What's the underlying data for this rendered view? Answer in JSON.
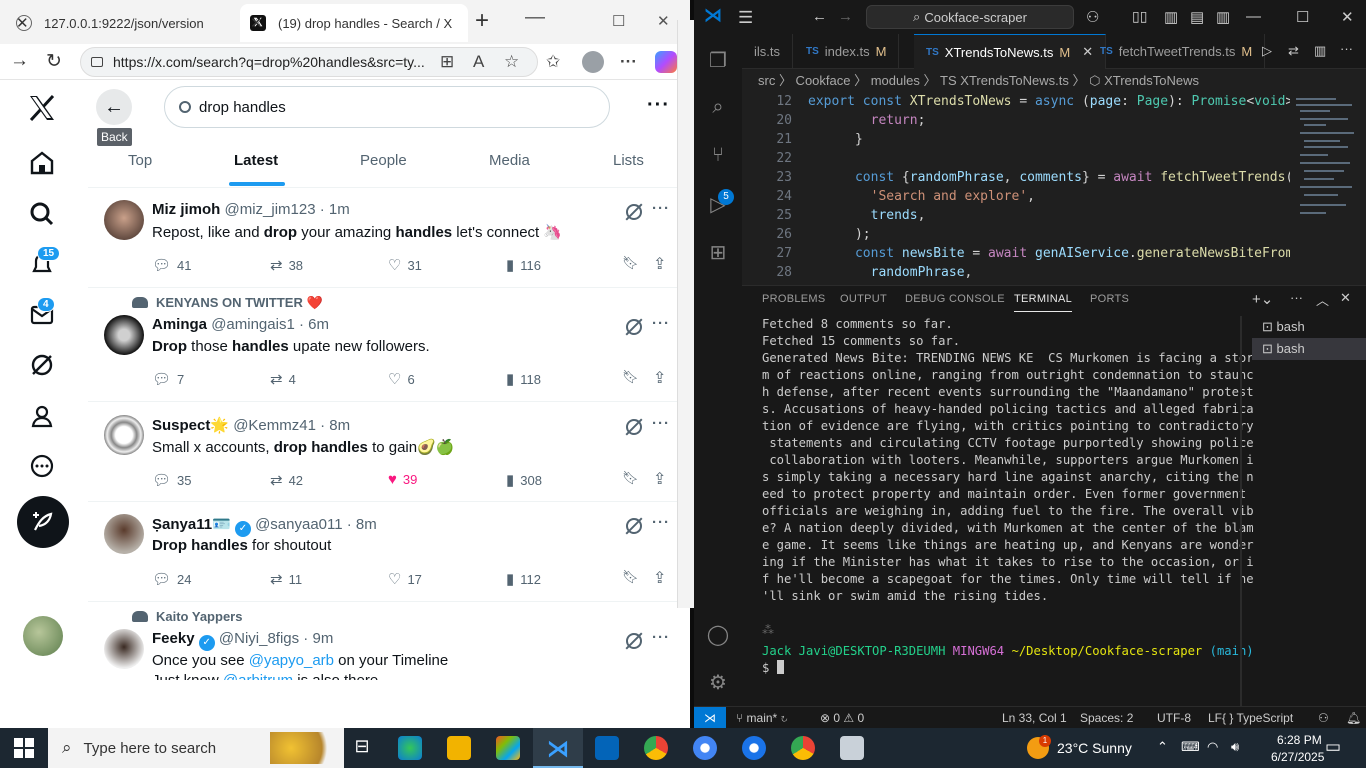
{
  "browser": {
    "tabs": [
      {
        "title": "127.0.0.1:9222/json/version"
      },
      {
        "title": "(19) drop handles - Search / X"
      }
    ],
    "address": "https://x.com/search?q=drop%20handles&src=ty..."
  },
  "x": {
    "back_tooltip": "Back",
    "search_value": "drop handles",
    "badges": {
      "notifications": "15",
      "messages": "4"
    },
    "tabs": [
      "Top",
      "Latest",
      "People",
      "Media",
      "Lists"
    ],
    "tweets": [
      {
        "name": "Miz jimoh",
        "handle": "@miz_jim123 · 1m",
        "context": "",
        "text_pre": "Repost, like and ",
        "b1": "drop",
        "text_mid": " your amazing ",
        "b2": "handles",
        "text_post": " let's connect 🦄",
        "replies": "41",
        "reposts": "38",
        "likes": "31",
        "views": "116"
      },
      {
        "name": "Aminga",
        "handle": "@amingais1 · 6m",
        "context": "KENYANS ON TWITTER ❤️",
        "text_pre": "",
        "b1": "Drop",
        "text_mid": " those ",
        "b2": "handles",
        "text_post": " upate new followers.",
        "replies": "7",
        "reposts": "4",
        "likes": "6",
        "views": "118"
      },
      {
        "name": "Suspect🌟",
        "handle": "@Kemmz41 · 8m",
        "context": "",
        "text_pre": "Small x accounts, ",
        "b1": "drop handles",
        "text_mid": "",
        "b2": "",
        "text_post": " to gain🥑🍏",
        "replies": "35",
        "reposts": "42",
        "likes": "39",
        "views": "308"
      },
      {
        "name": "Ṣanya11🪪",
        "handle": "@sanyaa011 · 8m",
        "context": "",
        "text_pre": "",
        "b1": "Drop handles",
        "text_mid": "",
        "b2": "",
        "text_post": " for shoutout",
        "replies": "24",
        "reposts": "11",
        "likes": "17",
        "views": "112"
      },
      {
        "name": "Feeky",
        "handle": "@Niyi_8figs · 9m",
        "context": "Kaito Yappers",
        "text_pre": "Once you see ",
        "link1": "@yapyo_arb",
        "text_post": " on your Timeline",
        "line2_pre": "Just know ",
        "link2": "@arbitrum",
        "line2_post": " is also there"
      }
    ]
  },
  "vscode": {
    "command_center": "Cookface-scraper",
    "tabs": [
      {
        "name": "ils.ts"
      },
      {
        "name": "index.ts",
        "m": "M"
      },
      {
        "name": "XTrendsToNews.ts",
        "m": "M"
      },
      {
        "name": "fetchTweetTrends.ts",
        "m": "M"
      }
    ],
    "breadcrumb": "src 〉 Cookface 〉 modules 〉 TS XTrendsToNews.ts 〉 ⬡ XTrendsToNews",
    "panel_tabs": [
      "PROBLEMS",
      "OUTPUT",
      "DEBUG CONSOLE",
      "TERMINAL",
      "PORTS"
    ],
    "terminal_lines": [
      "Fetched 8 comments so far.",
      "Fetched 15 comments so far.",
      "Generated News Bite: TRENDING NEWS KE  CS Murkomen is facing a stor",
      "m of reactions online, ranging from outright condemnation to staunc",
      "h defense, after recent events surrounding the \"Maandamano\" protest",
      "s. Accusations of heavy-handed policing tactics and alleged fabrica",
      "tion of evidence are flying, with critics pointing to contradictory",
      " statements and circulating CCTV footage purportedly showing police",
      " collaboration with looters. Meanwhile, supporters argue Murkomen i",
      "s simply taking a necessary hard line against anarchy, citing the n",
      "eed to protect property and maintain order. Even former government ",
      "officials are weighing in, adding fuel to the fire. The overall vib",
      "e? A nation deeply divided, with Murkomen at the center of the blam",
      "e game. It seems like things are heating up, and Kenyans are wonder",
      "ing if the Minister has what it takes to rise to the occasion, or i",
      "f he'll become a scapegoat for the times. Only time will tell if he",
      "'ll sink or swim amid the rising tides."
    ],
    "prompt_user": "Jack Javi@DESKTOP-R3DEUMH",
    "prompt_env": "MINGW64",
    "prompt_path": "~/Desktop/Cookface-scraper",
    "prompt_branch": "(main)",
    "terminals": [
      "bash",
      "bash"
    ],
    "status": {
      "branch": "main*",
      "errors": "⊗ 0 ⚠ 0",
      "position": "Ln 33, Col 1",
      "spaces": "Spaces: 2",
      "encoding": "UTF-8",
      "eol": "LF",
      "language": "{ } TypeScript"
    },
    "scm_badge": "5"
  },
  "taskbar": {
    "search_placeholder": "Type here to search",
    "weather": "23°C  Sunny",
    "time": "6:28 PM",
    "date": "6/27/2025",
    "weather_badge": "1"
  }
}
